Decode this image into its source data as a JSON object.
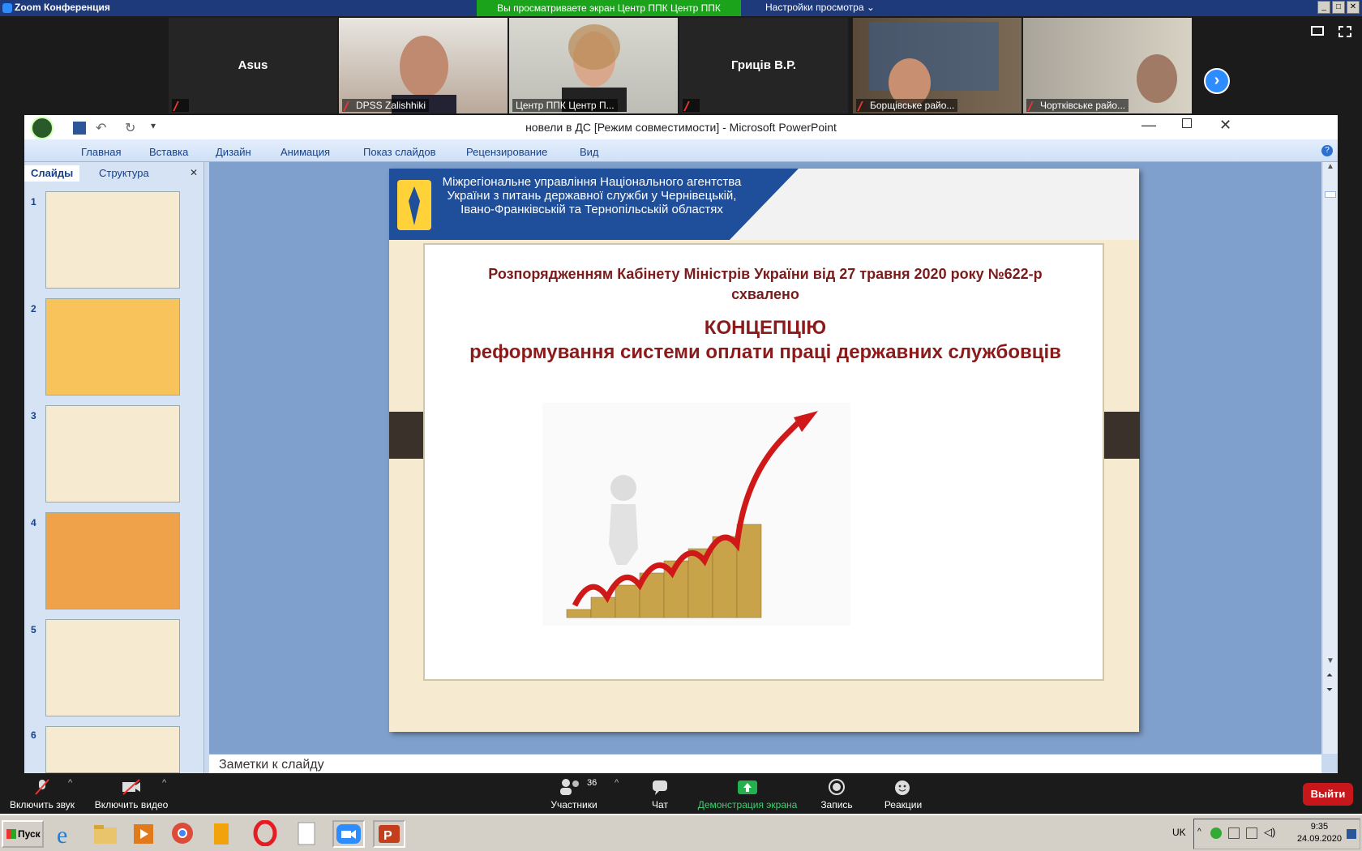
{
  "zoom": {
    "window_title": "Zoom Конференция",
    "share_banner": "Вы просматриваете экран Центр ППК Центр ППК",
    "view_options": "Настройки просмотра ⌄",
    "participants": [
      {
        "name": "Asus",
        "label": "",
        "video": false
      },
      {
        "name": "",
        "label": "DPSS Zalishhiki",
        "video": true
      },
      {
        "name": "",
        "label": "Центр ППК Центр П...",
        "video": true
      },
      {
        "name": "Гриців В.Р.",
        "label": "",
        "video": false
      },
      {
        "name": "",
        "label": "Борщівське райо...",
        "video": true
      },
      {
        "name": "",
        "label": "Чортківське райо...",
        "video": true
      }
    ],
    "controls": {
      "mute": "Включить звук",
      "video": "Включить видео",
      "participants_count": "36",
      "participants": "Участники",
      "chat": "Чат",
      "share": "Демонстрация экрана",
      "record": "Запись",
      "reactions": "Реакции",
      "leave": "Выйти"
    }
  },
  "ppt": {
    "title": "новели в ДС [Режим совместимости] - Microsoft PowerPoint",
    "ribbon_tabs": [
      "Главная",
      "Вставка",
      "Дизайн",
      "Анимация",
      "Показ слайдов",
      "Рецензирование",
      "Вид"
    ],
    "pane_tabs": [
      "Слайды",
      "Структура"
    ],
    "slide_numbers": [
      "1",
      "2",
      "3",
      "4",
      "5",
      "6"
    ],
    "notes_placeholder": "Заметки к слайду",
    "slide": {
      "header": "Міжрегіональне управління Національного агентства України з питань державної служби у Чернівецькій, Івано-Франківській та Тернопільській областях",
      "order": "Розпорядженням Кабінету Міністрів України від 27 травня 2020 року №622-р схвалено",
      "concept_title": "КОНЦЕПЦІЮ",
      "concept_body": "реформування системи оплати праці державних службовців"
    }
  },
  "taskbar": {
    "start": "Пуск",
    "lang": "UK",
    "time": "9:35",
    "date": "24.09.2020"
  }
}
